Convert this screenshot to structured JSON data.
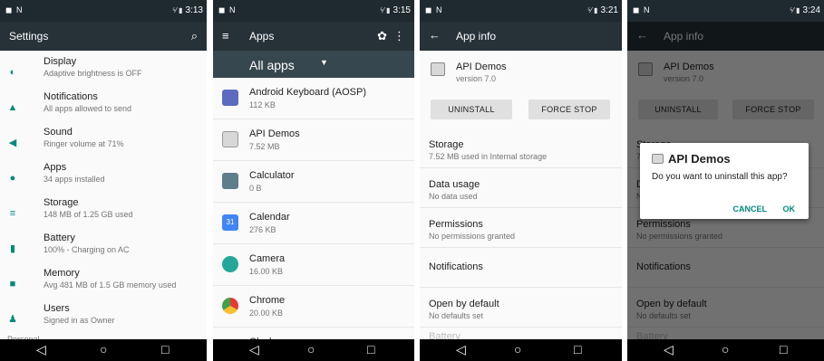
{
  "colors": {
    "accent": "#00897b",
    "toolbar": "#263238",
    "statusbar": "#1f2a30"
  },
  "statusbar": {
    "left": "◼ N",
    "signal": "⁵⁄ ▮",
    "times": [
      "3:13",
      "3:15",
      "3:21",
      "3:24"
    ]
  },
  "navbar": {
    "back": "◁",
    "home": "○",
    "recents": "□"
  },
  "settings": {
    "title": "Settings",
    "items": [
      {
        "title": "Display",
        "subtitle": "Adaptive brightness is OFF",
        "icon": "display-icon"
      },
      {
        "title": "Notifications",
        "subtitle": "All apps allowed to send",
        "icon": "bell-icon"
      },
      {
        "title": "Sound",
        "subtitle": "Ringer volume at 71%",
        "icon": "volume-icon"
      },
      {
        "title": "Apps",
        "subtitle": "34 apps installed",
        "icon": "android-icon"
      },
      {
        "title": "Storage",
        "subtitle": "148 MB of 1.25 GB used",
        "icon": "storage-icon"
      },
      {
        "title": "Battery",
        "subtitle": "100% - Charging on AC",
        "icon": "battery-icon"
      },
      {
        "title": "Memory",
        "subtitle": "Avg 481 MB of 1.5 GB memory used",
        "icon": "memory-icon"
      },
      {
        "title": "Users",
        "subtitle": "Signed in as Owner",
        "icon": "user-icon"
      }
    ],
    "section": "Personal"
  },
  "apps": {
    "title": "Apps",
    "filter": "All apps",
    "items": [
      {
        "name": "Android Keyboard (AOSP)",
        "size": "112 KB",
        "color": "#5c6bc0"
      },
      {
        "name": "API Demos",
        "size": "7.52 MB",
        "color": "#d8d8d8"
      },
      {
        "name": "Calculator",
        "size": "0 B",
        "color": "#607d8b"
      },
      {
        "name": "Calendar",
        "size": "276 KB",
        "color": "#4285f4"
      },
      {
        "name": "Camera",
        "size": "16.00 KB",
        "color": "#26a69a"
      },
      {
        "name": "Chrome",
        "size": "20.00 KB",
        "color": "#e53935"
      },
      {
        "name": "Clock",
        "size": "",
        "color": "#3f51b5"
      }
    ]
  },
  "appinfo": {
    "title": "App info",
    "app_name": "API Demos",
    "version": "version 7.0",
    "uninstall": "UNINSTALL",
    "force_stop": "FORCE STOP",
    "sections": [
      {
        "title": "Storage",
        "subtitle": "7.52 MB used in Internal storage"
      },
      {
        "title": "Data usage",
        "subtitle": "No data used"
      },
      {
        "title": "Permissions",
        "subtitle": "No permissions granted"
      },
      {
        "title": "Notifications",
        "subtitle": ""
      },
      {
        "title": "Open by default",
        "subtitle": "No defaults set"
      },
      {
        "title": "Battery",
        "subtitle": ""
      }
    ]
  },
  "dialog": {
    "title": "API Demos",
    "message": "Do you want to uninstall this app?",
    "cancel": "CANCEL",
    "ok": "OK"
  }
}
